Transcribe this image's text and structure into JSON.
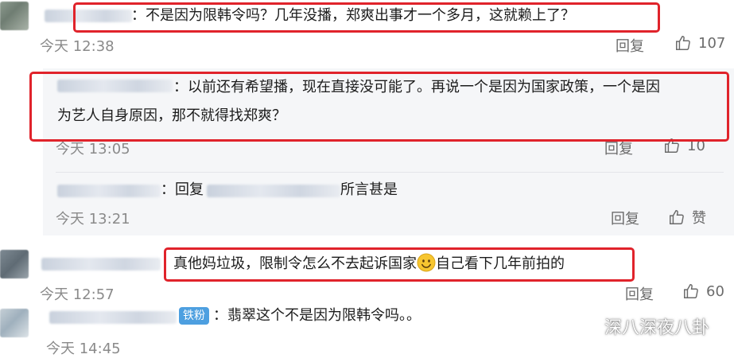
{
  "comments": [
    {
      "text": "：不是因为限韩令吗？几年没播，郑爽出事才一个多月，这就赖上了？",
      "time": "今天 12:38",
      "reply_label": "回复",
      "likes": "107"
    },
    {
      "text_line1": "：以前还有希望播，现在直接没可能了。再说一个是因为国家政策，一个是因",
      "text_line2": "为艺人自身原因，那不就得找郑爽？",
      "time": "今天 13:05",
      "reply_label": "回复",
      "likes": "10"
    },
    {
      "prefix": "：回复",
      "text": "所言甚是",
      "time": "今天 13:21",
      "reply_label": "回复",
      "likes": "赞"
    },
    {
      "text_before_emoji": "真他妈垃圾，限制令怎么不去起诉国家",
      "emoji": "smiley-emoji",
      "text_after_emoji": "自己看下几年前拍的",
      "time": "今天 12:57",
      "reply_label": "回复",
      "likes": "60"
    },
    {
      "badge": "铁粉",
      "text": "：翡翠这个不是因为限韩令吗。。",
      "time": "今天 14:45"
    }
  ],
  "watermark": {
    "text": "深八深夜八卦",
    "icon": "wechat-icon"
  },
  "colors": {
    "highlight_border": "#e0232b",
    "badge": "#4d9fe0",
    "subpanel": "#f5f6f8"
  }
}
